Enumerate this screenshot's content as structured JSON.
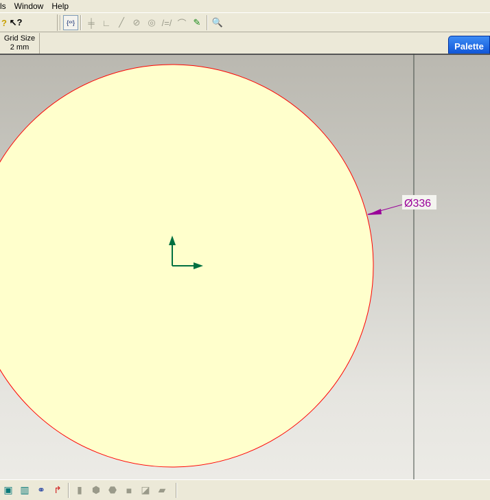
{
  "menu": [
    "ls",
    "Window",
    "Help"
  ],
  "grid": {
    "label": "Grid Size",
    "value": "2 mm"
  },
  "palette": "Palette",
  "dimension": "Ø336",
  "colors": {
    "circle_fill": "#ffffcc",
    "circle_stroke": "#ff0000",
    "dimension": "#990099",
    "axis": "#007040",
    "palette": "#1c64e4"
  }
}
